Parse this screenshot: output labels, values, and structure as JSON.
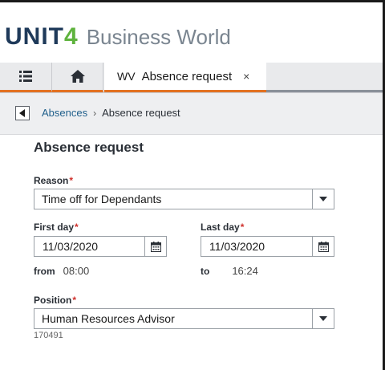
{
  "brand": {
    "logo_prefix": "UNIT",
    "logo_suffix": "4",
    "product": "Business World"
  },
  "tabs": {
    "active": {
      "code": "WV",
      "title": "Absence request",
      "close": "×"
    }
  },
  "breadcrumb": {
    "parent": "Absences",
    "separator": "›",
    "current": "Absence request"
  },
  "form": {
    "title": "Absence request",
    "reason": {
      "label": "Reason",
      "required": "*",
      "value": "Time off for Dependants"
    },
    "first_day": {
      "label": "First day",
      "required": "*",
      "value": "11/03/2020",
      "from_label": "from",
      "from_time": "08:00"
    },
    "last_day": {
      "label": "Last day",
      "required": "*",
      "value": "11/03/2020",
      "to_label": "to",
      "to_time": "16:24"
    },
    "position": {
      "label": "Position",
      "required": "*",
      "value": "Human Resources Advisor",
      "code": "170491"
    }
  },
  "colors": {
    "accent": "#e37222",
    "brand_green": "#5fb33e",
    "brand_navy": "#1f3a5a",
    "required": "#d0312d",
    "link": "#1f5f8b"
  }
}
